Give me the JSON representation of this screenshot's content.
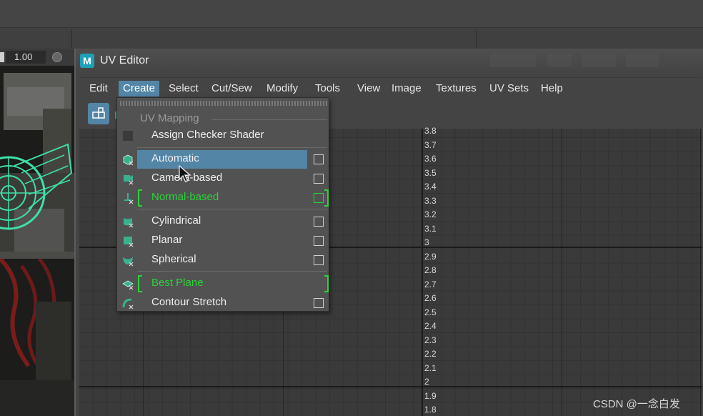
{
  "main": {
    "zoom_value": "1.00"
  },
  "uv_editor": {
    "title": "UV Editor",
    "logo_letter": "M",
    "menus": [
      "Edit",
      "Create",
      "Select",
      "Cut/Sew",
      "Modify",
      "Tools",
      "View",
      "Image",
      "Textures",
      "UV Sets",
      "Help"
    ],
    "active_menu": "Create",
    "axis_labels": [
      "3.8",
      "3.7",
      "3.6",
      "3.5",
      "3.4",
      "3.3",
      "3.2",
      "3.1",
      "3",
      "2.9",
      "2.8",
      "2.7",
      "2.6",
      "2.5",
      "2.4",
      "2.3",
      "2.2",
      "2.1",
      "2",
      "1.9",
      "1.8"
    ]
  },
  "create_menu": {
    "section": "UV Mapping",
    "items": [
      {
        "label": "Assign Checker Shader",
        "icon": "checker-icon",
        "option_box": false,
        "state": "normal"
      },
      {
        "label": "Automatic",
        "icon": "automatic-mapping-icon",
        "option_box": true,
        "state": "highlighted"
      },
      {
        "label": "Camera-based",
        "icon": "camera-mapping-icon",
        "option_box": true,
        "state": "normal"
      },
      {
        "label": "Normal-based",
        "icon": "normal-mapping-icon",
        "option_box": true,
        "state": "marked"
      },
      {
        "label": "Cylindrical",
        "icon": "cylindrical-mapping-icon",
        "option_box": true,
        "state": "normal"
      },
      {
        "label": "Planar",
        "icon": "planar-mapping-icon",
        "option_box": true,
        "state": "normal"
      },
      {
        "label": "Spherical",
        "icon": "spherical-mapping-icon",
        "option_box": true,
        "state": "normal"
      },
      {
        "label": "Best Plane",
        "icon": "best-plane-icon",
        "option_box": false,
        "state": "marked"
      },
      {
        "label": "Contour Stretch",
        "icon": "contour-stretch-icon",
        "option_box": true,
        "state": "normal"
      }
    ]
  },
  "watermark": "CSDN @一念白发",
  "colors": {
    "highlight": "#5285a6",
    "marked_green": "#2bd23a",
    "menu_bg": "#525252"
  }
}
